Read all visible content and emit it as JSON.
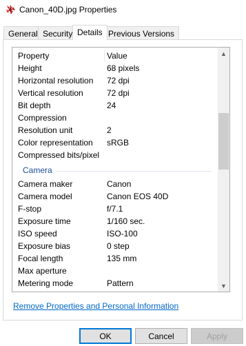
{
  "window": {
    "title": "Canon_40D.jpg Properties",
    "icon": "image-file-icon"
  },
  "tabs": [
    {
      "label": "General",
      "active": false
    },
    {
      "label": "Security",
      "active": false
    },
    {
      "label": "Details",
      "active": true
    },
    {
      "label": "Previous Versions",
      "active": false
    }
  ],
  "list": {
    "header": {
      "property": "Property",
      "value": "Value"
    },
    "rows": [
      {
        "property": "Height",
        "value": "68 pixels"
      },
      {
        "property": "Horizontal resolution",
        "value": "72 dpi"
      },
      {
        "property": "Vertical resolution",
        "value": "72 dpi"
      },
      {
        "property": "Bit depth",
        "value": "24"
      },
      {
        "property": "Compression",
        "value": ""
      },
      {
        "property": "Resolution unit",
        "value": "2"
      },
      {
        "property": "Color representation",
        "value": "sRGB"
      },
      {
        "property": "Compressed bits/pixel",
        "value": ""
      }
    ],
    "group": "Camera",
    "camera_rows": [
      {
        "property": "Camera maker",
        "value": "Canon"
      },
      {
        "property": "Camera model",
        "value": "Canon EOS 40D"
      },
      {
        "property": "F-stop",
        "value": "f/7.1"
      },
      {
        "property": "Exposure time",
        "value": "1/160 sec."
      },
      {
        "property": "ISO speed",
        "value": "ISO-100"
      },
      {
        "property": "Exposure bias",
        "value": "0 step"
      },
      {
        "property": "Focal length",
        "value": "135 mm"
      },
      {
        "property": "Max aperture",
        "value": ""
      },
      {
        "property": "Metering mode",
        "value": "Pattern"
      }
    ],
    "scroll_position_fraction": 0.28
  },
  "link": "Remove Properties and Personal Information",
  "buttons": {
    "ok": "OK",
    "cancel": "Cancel",
    "apply": "Apply"
  },
  "colors": {
    "link": "#0066cc",
    "group_header": "#1e4e99",
    "default_button_border": "#0078d7"
  }
}
